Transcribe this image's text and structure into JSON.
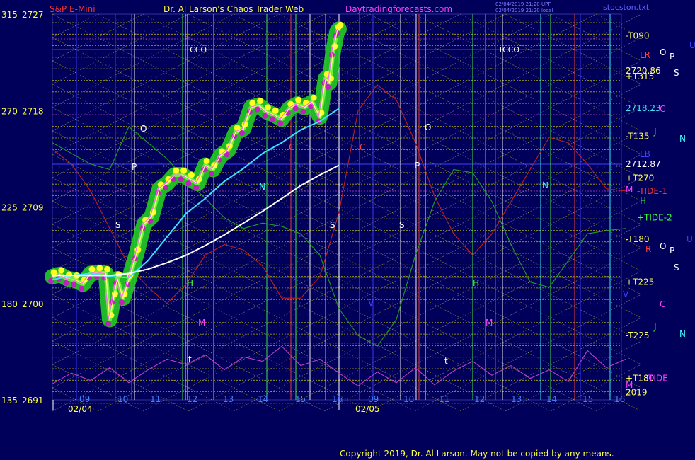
{
  "header": {
    "symbol": "S&P E-Mini",
    "title": "Dr. Al Larson's Chaos Trader Web",
    "site": "Daytradingforecasts.com",
    "stamp_1": "02/04/2019 21:20 UPF",
    "stamp_2": "02/04/2019 21:20 local",
    "corner": "stocston.txt"
  },
  "footer": {
    "copyright": "Copyright 2019, Dr. Al Larson. May not be copied by any means."
  },
  "colors": {
    "background": "#00005a",
    "grid_yellow": "#d8d800",
    "grid_white": "#c0c0c0",
    "ema_cyan": "#40e0ff",
    "ema_white": "#ffffff",
    "price_glow": "#22cc22",
    "tide_red": "#c02020",
    "tide_green": "#20a020",
    "osc_magenta": "#c040c0"
  },
  "chart_data": {
    "type": "line",
    "left_axis": {
      "ticks": [
        {
          "angle": "315",
          "price": 2727
        },
        {
          "angle": "270",
          "price": 2718
        },
        {
          "angle": "225",
          "price": 2709
        },
        {
          "angle": "180",
          "price": 2700
        },
        {
          "angle": "135",
          "price": 2691
        }
      ],
      "ylim": [
        2691,
        2727
      ]
    },
    "x_axis": {
      "dates": [
        "02/04",
        "02/05"
      ],
      "hour_ticks": [
        "09",
        "10",
        "11",
        "12",
        "13",
        "14",
        "15",
        "16",
        "09",
        "10",
        "11",
        "12",
        "13",
        "14",
        "15",
        "16"
      ]
    },
    "right_labels": [
      {
        "text": "-T090",
        "price": 2725,
        "color": "#ffff60"
      },
      {
        "text": "+T315",
        "price": 2721.2,
        "color": "#ffff60"
      },
      {
        "text": "2720.86",
        "price": 2721.7,
        "color": "#ffff60"
      },
      {
        "text": "2718.23",
        "price": 2718.2,
        "color": "#40e0ff"
      },
      {
        "text": "-T135",
        "price": 2715.6,
        "color": "#ffff60"
      },
      {
        "text": "2712.87",
        "price": 2713.0,
        "color": "#ffffff"
      },
      {
        "text": "+T270",
        "price": 2711.7,
        "color": "#ffff60"
      },
      {
        "text": "-TIDE-1",
        "price": 2710.5,
        "color": "#ff3030"
      },
      {
        "text": "+TIDE-2",
        "price": 2708.0,
        "color": "#40ff40"
      },
      {
        "text": "-T180",
        "price": 2706.0,
        "color": "#ffff60"
      },
      {
        "text": "+T225",
        "price": 2702.0,
        "color": "#ffff60"
      },
      {
        "text": "-T225",
        "price": 2697.0,
        "color": "#ffff60"
      },
      {
        "text": "+T180",
        "price": 2693.0,
        "color": "#ffff60"
      },
      {
        "text": "TIDE",
        "price": 2693.0,
        "color": "#ff40ff"
      },
      {
        "text": "2019",
        "price": 2691.7,
        "color": "#ffff60"
      }
    ],
    "planet_labels_right": [
      {
        "text": "LR",
        "color": "#ff4040"
      },
      {
        "text": "O",
        "color": "#ffffff"
      },
      {
        "text": "P",
        "color": "#ffffff"
      },
      {
        "text": "U",
        "color": "#4040ff"
      },
      {
        "text": "S",
        "color": "#ffffff"
      },
      {
        "text": "C",
        "color": "#ff40ff"
      },
      {
        "text": "J",
        "color": "#40ff40"
      },
      {
        "text": "N",
        "color": "#40ffff"
      },
      {
        "text": "LB",
        "color": "#4040ff"
      },
      {
        "text": "M",
        "color": "#ff40ff"
      },
      {
        "text": "H",
        "color": "#40ff40"
      },
      {
        "text": "R",
        "color": "#ff4040"
      },
      {
        "text": "O",
        "color": "#ffffff"
      },
      {
        "text": "P",
        "color": "#ffffff"
      },
      {
        "text": "U",
        "color": "#4040ff"
      },
      {
        "text": "S",
        "color": "#ffffff"
      },
      {
        "text": "V",
        "color": "#4040ff"
      },
      {
        "text": "C",
        "color": "#ff40ff"
      },
      {
        "text": "J",
        "color": "#40ff40"
      },
      {
        "text": "N",
        "color": "#40ffff"
      },
      {
        "text": "M",
        "color": "#ff40ff"
      }
    ],
    "chart_labels": [
      {
        "text": "TCCO",
        "color": "#ffffff"
      },
      {
        "text": "TCCO",
        "color": "#ffffff"
      },
      {
        "text": "O",
        "color": "#ffffff"
      },
      {
        "text": "P",
        "color": "#ffffff"
      },
      {
        "text": "S",
        "color": "#ffffff"
      },
      {
        "text": "H",
        "color": "#40ff40"
      },
      {
        "text": "M",
        "color": "#ff40ff"
      },
      {
        "text": "t",
        "color": "#ffffff"
      },
      {
        "text": "N",
        "color": "#40ffff"
      },
      {
        "text": "S",
        "color": "#ffffff"
      },
      {
        "text": "C",
        "color": "#ff4040"
      },
      {
        "text": "O",
        "color": "#ffffff"
      },
      {
        "text": "P",
        "color": "#ffffff"
      },
      {
        "text": "S",
        "color": "#ffffff"
      },
      {
        "text": "V",
        "color": "#4040ff"
      },
      {
        "text": "H",
        "color": "#40ff40"
      },
      {
        "text": "M",
        "color": "#ff40ff"
      },
      {
        "text": "t",
        "color": "#ffffff"
      },
      {
        "text": "N",
        "color": "#40ffff"
      },
      {
        "text": "C",
        "color": "#ff4040"
      }
    ],
    "series": [
      {
        "name": "price",
        "day": 1,
        "hours": [
          8.5,
          8.7,
          8.9,
          9.1,
          9.3,
          9.5,
          9.7,
          9.9,
          10.0,
          10.1,
          10.2,
          10.35,
          10.5,
          10.7,
          10.9,
          11.1,
          11.3,
          11.5,
          11.7,
          11.9,
          12.1,
          12.3,
          12.5,
          12.7,
          12.9,
          13.1,
          13.3,
          13.5,
          13.7,
          13.9,
          14.1,
          14.3,
          14.5,
          14.7,
          14.9,
          15.1,
          15.3,
          15.5,
          15.65,
          15.75,
          15.85,
          15.95,
          16.0
        ],
        "values": [
          2702.5,
          2702.7,
          2702.3,
          2702.2,
          2701.8,
          2702.8,
          2702.9,
          2702.8,
          2698.5,
          2700.5,
          2702.3,
          2700.5,
          2702.2,
          2704.6,
          2707.4,
          2708.1,
          2710.7,
          2711.2,
          2712.0,
          2712.0,
          2711.6,
          2711.2,
          2712.9,
          2712.5,
          2713.8,
          2714.3,
          2716.0,
          2716.3,
          2718.3,
          2718.5,
          2717.9,
          2717.6,
          2717.2,
          2718.2,
          2718.6,
          2718.3,
          2718.8,
          2717.4,
          2721.0,
          2720.6,
          2723.6,
          2725.4,
          2725.6
        ]
      },
      {
        "name": "ema_fast",
        "day": 1,
        "hours": [
          8.5,
          9.0,
          9.5,
          10.0,
          10.5,
          11.0,
          11.5,
          12.0,
          12.5,
          13.0,
          13.5,
          14.0,
          14.5,
          15.0,
          15.5,
          16.0
        ],
        "values": [
          2702.2,
          2702.6,
          2702.8,
          2702.5,
          2702.4,
          2704.0,
          2706.2,
          2708.4,
          2709.8,
          2711.4,
          2712.6,
          2714.0,
          2715.0,
          2716.2,
          2717.0,
          2718.2
        ]
      },
      {
        "name": "ema_slow",
        "day": 1,
        "hours": [
          8.5,
          9.0,
          9.5,
          10.0,
          10.5,
          11.0,
          11.5,
          12.0,
          12.5,
          13.0,
          13.5,
          14.0,
          14.5,
          15.0,
          15.5,
          16.0
        ],
        "values": [
          2702.6,
          2702.6,
          2702.6,
          2702.6,
          2702.8,
          2703.2,
          2703.8,
          2704.5,
          2705.4,
          2706.4,
          2707.5,
          2708.6,
          2709.8,
          2711.0,
          2712.0,
          2712.9
        ]
      },
      {
        "name": "tide_red",
        "day": 1,
        "hours": [
          8.5,
          9.0,
          9.5,
          10.0,
          10.5,
          11.0,
          11.5,
          12.0,
          12.5,
          13.0,
          13.5,
          14.0,
          14.5,
          15.0,
          15.5,
          16.0,
          16.5,
          17.0,
          17.5,
          18.0,
          18.5,
          19.0,
          19.5,
          20.0,
          20.5,
          21.0,
          21.5,
          22.0,
          22.5,
          23.0,
          23.5
        ],
        "values": [
          2714.4,
          2713.0,
          2710.5,
          2707.0,
          2703.5,
          2701.5,
          2700.0,
          2701.8,
          2704.5,
          2705.5,
          2705.0,
          2703.5,
          2700.5,
          2700.5,
          2702.5,
          2708.5,
          2718.0,
          2720.4,
          2719.0,
          2715.0,
          2710.0,
          2706.5,
          2704.5,
          2706.5,
          2709.5,
          2712.5,
          2715.5,
          2715.0,
          2713.0,
          2710.7,
          2710.5
        ]
      },
      {
        "name": "tide_green",
        "day": 1,
        "hours": [
          8.5,
          9.0,
          9.5,
          10.0,
          10.5,
          11.0,
          11.5,
          12.0,
          12.5,
          13.0,
          13.5,
          14.0,
          14.5,
          15.0,
          15.5,
          16.0,
          16.5,
          17.0,
          17.5,
          18.0,
          18.5,
          19.0,
          19.5,
          20.0,
          20.5,
          21.0,
          21.5,
          22.0,
          22.5,
          23.0,
          23.5
        ],
        "values": [
          2715.0,
          2714.0,
          2713.0,
          2712.5,
          2716.5,
          2715.0,
          2713.5,
          2711.5,
          2709.8,
          2708.0,
          2707.0,
          2707.5,
          2707.2,
          2706.5,
          2704.5,
          2699.5,
          2697.0,
          2696.0,
          2698.5,
          2704.5,
          2709.5,
          2712.5,
          2712.2,
          2709.5,
          2705.5,
          2702.0,
          2701.5,
          2704.0,
          2706.5,
          2706.8,
          2707.0
        ]
      },
      {
        "name": "oscillator",
        "day": 1,
        "hours": [
          8.5,
          9.0,
          9.5,
          10.0,
          10.5,
          11.0,
          11.5,
          12.0,
          12.5,
          13.0,
          13.5,
          14.0,
          14.5,
          15.0,
          15.5,
          16.0,
          16.5,
          17.0,
          17.5,
          18.0,
          18.5,
          19.0,
          19.5,
          20.0,
          20.5,
          21.0,
          21.5,
          22.0,
          22.5,
          23.0,
          23.5
        ],
        "values": [
          2692.5,
          2693.5,
          2692.8,
          2694.0,
          2692.6,
          2693.8,
          2694.8,
          2694.3,
          2695.2,
          2693.8,
          2695.0,
          2694.6,
          2696.0,
          2694.2,
          2694.8,
          2693.5,
          2692.3,
          2693.6,
          2692.6,
          2694.0,
          2692.4,
          2693.7,
          2694.6,
          2693.3,
          2694.2,
          2693.0,
          2693.8,
          2692.7,
          2695.6,
          2694.0,
          2694.8
        ]
      }
    ]
  }
}
